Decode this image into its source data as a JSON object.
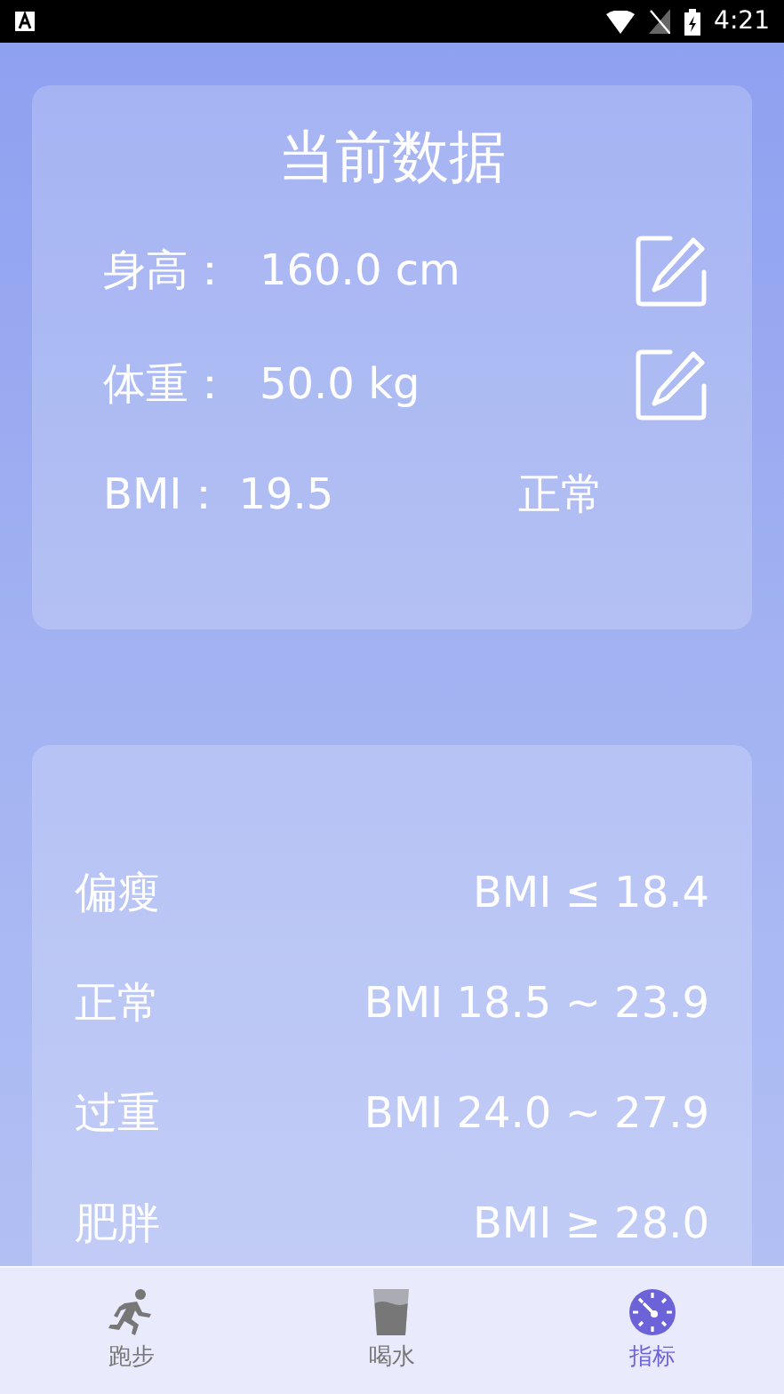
{
  "status_bar": {
    "time": "4:21"
  },
  "current_data": {
    "title": "当前数据",
    "measurements": [
      {
        "label": "身高：",
        "value": "160.0 cm",
        "editable": true
      },
      {
        "label": "体重：",
        "value": "50.0 kg",
        "editable": true
      }
    ],
    "bmi": {
      "label": "BMI：",
      "value": "19.5",
      "status": "正常"
    }
  },
  "bmi_ranges": [
    {
      "label": "偏瘦",
      "range": "BMI ≤ 18.4"
    },
    {
      "label": "正常",
      "range": "BMI 18.5 ~ 23.9"
    },
    {
      "label": "过重",
      "range": "BMI 24.0 ~ 27.9"
    },
    {
      "label": "肥胖",
      "range": "BMI ≥ 28.0"
    }
  ],
  "bottom_nav": [
    {
      "label": "跑步",
      "kind": "run",
      "selected": false
    },
    {
      "label": "喝水",
      "kind": "water",
      "selected": false
    },
    {
      "label": "指标",
      "kind": "gauge",
      "selected": true
    }
  ]
}
